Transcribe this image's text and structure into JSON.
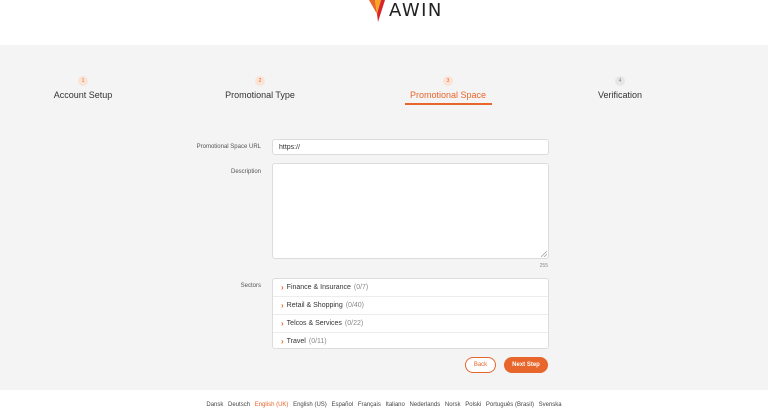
{
  "brand": {
    "name": "AWIN",
    "accent": "#e8652b"
  },
  "steps": [
    {
      "number": "1",
      "label": "Account Setup",
      "active": false
    },
    {
      "number": "2",
      "label": "Promotional Type",
      "active": false
    },
    {
      "number": "3",
      "label": "Promotional Space",
      "active": true
    },
    {
      "number": "4",
      "label": "Verification",
      "active": false
    }
  ],
  "form": {
    "url_label": "Promotional Space URL",
    "url_value": "https://",
    "description_label": "Description",
    "description_value": "",
    "char_count": "255",
    "sectors_label": "Sectors",
    "sectors": [
      {
        "name": "Finance & Insurance",
        "count": "(0/7)"
      },
      {
        "name": "Retail & Shopping",
        "count": "(0/40)"
      },
      {
        "name": "Telcos & Services",
        "count": "(0/22)"
      },
      {
        "name": "Travel",
        "count": "(0/11)"
      }
    ]
  },
  "buttons": {
    "back": "Back",
    "next": "Next Step"
  },
  "footer": {
    "languages": [
      "Dansk",
      "Deutsch",
      "English (UK)",
      "English (US)",
      "Español",
      "Français",
      "Italiano",
      "Nederlands",
      "Norsk",
      "Polski",
      "Português (Brasil)",
      "Svenska"
    ],
    "active_language": "English (UK)"
  }
}
